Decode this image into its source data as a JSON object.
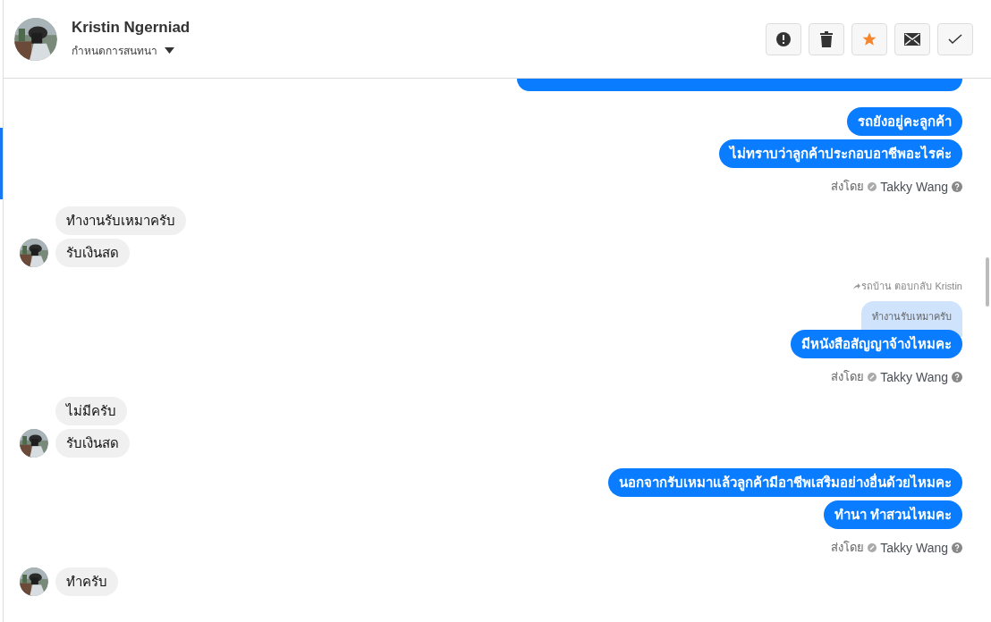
{
  "header": {
    "name": "Kristin Ngerniad",
    "menu_label": "กำหนดการสนทนา",
    "starred": true,
    "actions": [
      {
        "kind": "alert"
      },
      {
        "kind": "trash"
      },
      {
        "kind": "star"
      },
      {
        "kind": "mail"
      },
      {
        "kind": "check"
      }
    ]
  },
  "messages": [
    {
      "kind": "outgoing",
      "cut_top": true,
      "bubbles": [
        "รถยังอยู่คะลูกค้า",
        "ไม่ทราบว่าลูกค้าประกอบอาชีพอะไรค่ะ"
      ],
      "sent_label": "ส่งโดย",
      "sender": "Takky Wang"
    },
    {
      "kind": "incoming",
      "bubbles": [
        "ทำงานรับเหมาครับ",
        "รับเงินสด"
      ]
    },
    {
      "kind": "outgoing",
      "reply_label": "รถบ้าน ตอบกลับ Kristin",
      "quote": "ทำงานรับเหมาครับ",
      "bubbles": [
        "มีหนังสือสัญญาจ้างไหมคะ"
      ],
      "sent_label": "ส่งโดย",
      "sender": "Takky Wang"
    },
    {
      "kind": "incoming",
      "bubbles": [
        "ไม่มีครับ",
        "รับเงินสด"
      ]
    },
    {
      "kind": "outgoing",
      "bubbles": [
        "นอกจากรับเหมาแล้วลูกค้ามีอาชีพเสริมอย่างอื่นด้วยไหมคะ",
        "ทำนา ทำสวนไหมคะ"
      ],
      "sent_label": "ส่งโดย",
      "sender": "Takky Wang"
    },
    {
      "kind": "incoming",
      "bubbles": [
        "ทำครับ"
      ]
    }
  ]
}
